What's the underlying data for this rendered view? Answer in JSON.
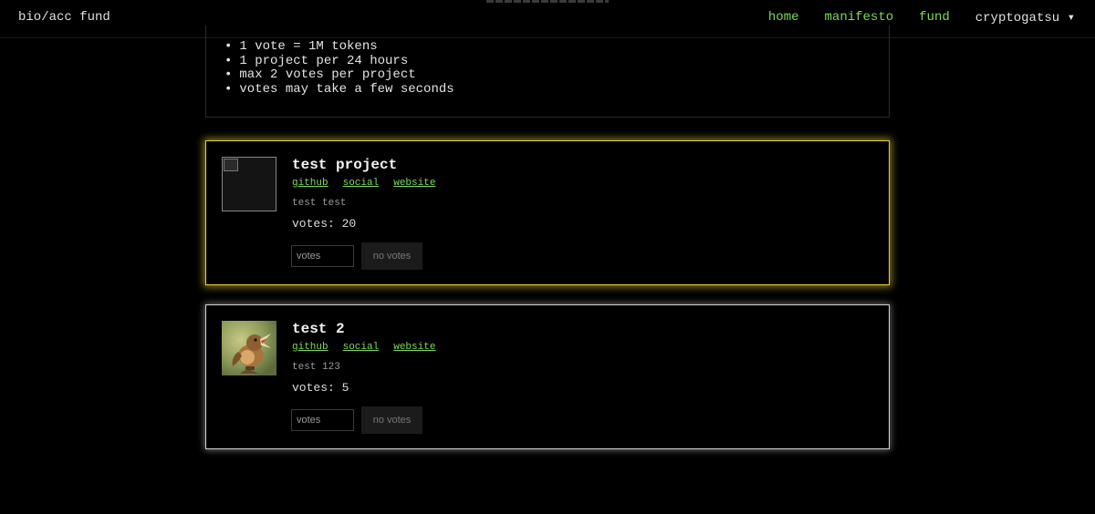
{
  "header": {
    "brand": "bio/acc fund",
    "nav": {
      "home": "home",
      "manifesto": "manifesto",
      "fund": "fund",
      "user": "cryptogatsu ▾"
    }
  },
  "rules": [
    "1 vote = 1M tokens",
    "1 project per 24 hours",
    "max 2 votes per project",
    "votes may take a few seconds"
  ],
  "projects": [
    {
      "title": "test project",
      "links": {
        "github": "github",
        "social": "social",
        "website": "website"
      },
      "description": "test test",
      "votes": "votes: 20",
      "input_placeholder": "votes",
      "button_label": "no votes",
      "image": "broken-image-icon",
      "highlight": "#e9cf3c"
    },
    {
      "title": "test 2",
      "links": {
        "github": "github",
        "social": "social",
        "website": "website"
      },
      "description": "test 123",
      "votes": "votes: 5",
      "input_placeholder": "votes",
      "button_label": "no votes",
      "image": "bird-photo",
      "highlight": "#d5d5d5"
    }
  ]
}
